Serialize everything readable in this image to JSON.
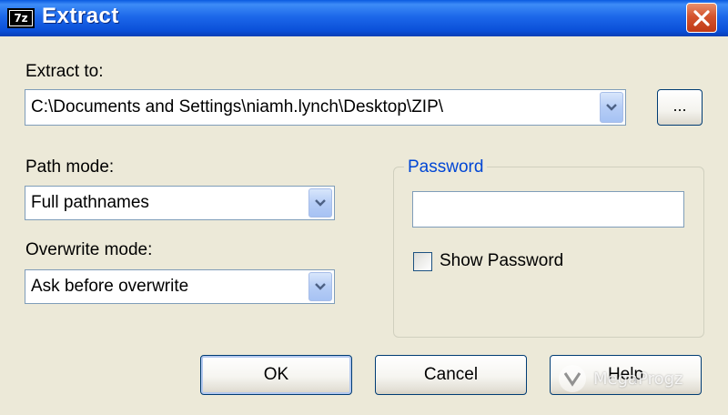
{
  "window": {
    "title": "Extract",
    "app_icon_label": "7z",
    "close_icon": "close-x-icon"
  },
  "extract_to": {
    "label": "Extract to:",
    "value": "C:\\Documents and Settings\\niamh.lynch\\Desktop\\ZIP\\",
    "browse_label": "..."
  },
  "path_mode": {
    "label": "Path mode:",
    "value": "Full pathnames"
  },
  "overwrite_mode": {
    "label": "Overwrite mode:",
    "value": "Ask before overwrite"
  },
  "password_group": {
    "legend": "Password",
    "value": "",
    "show_password_label": "Show Password",
    "show_password_checked": false
  },
  "buttons": {
    "ok": "OK",
    "cancel": "Cancel",
    "help": "Help"
  },
  "watermark": {
    "text": "MegaProgz"
  },
  "colors": {
    "titlebar": "#0a4fd8",
    "dialog_background": "#ece9d8",
    "group_legend": "#0046d5",
    "close_button": "#d4542e"
  }
}
